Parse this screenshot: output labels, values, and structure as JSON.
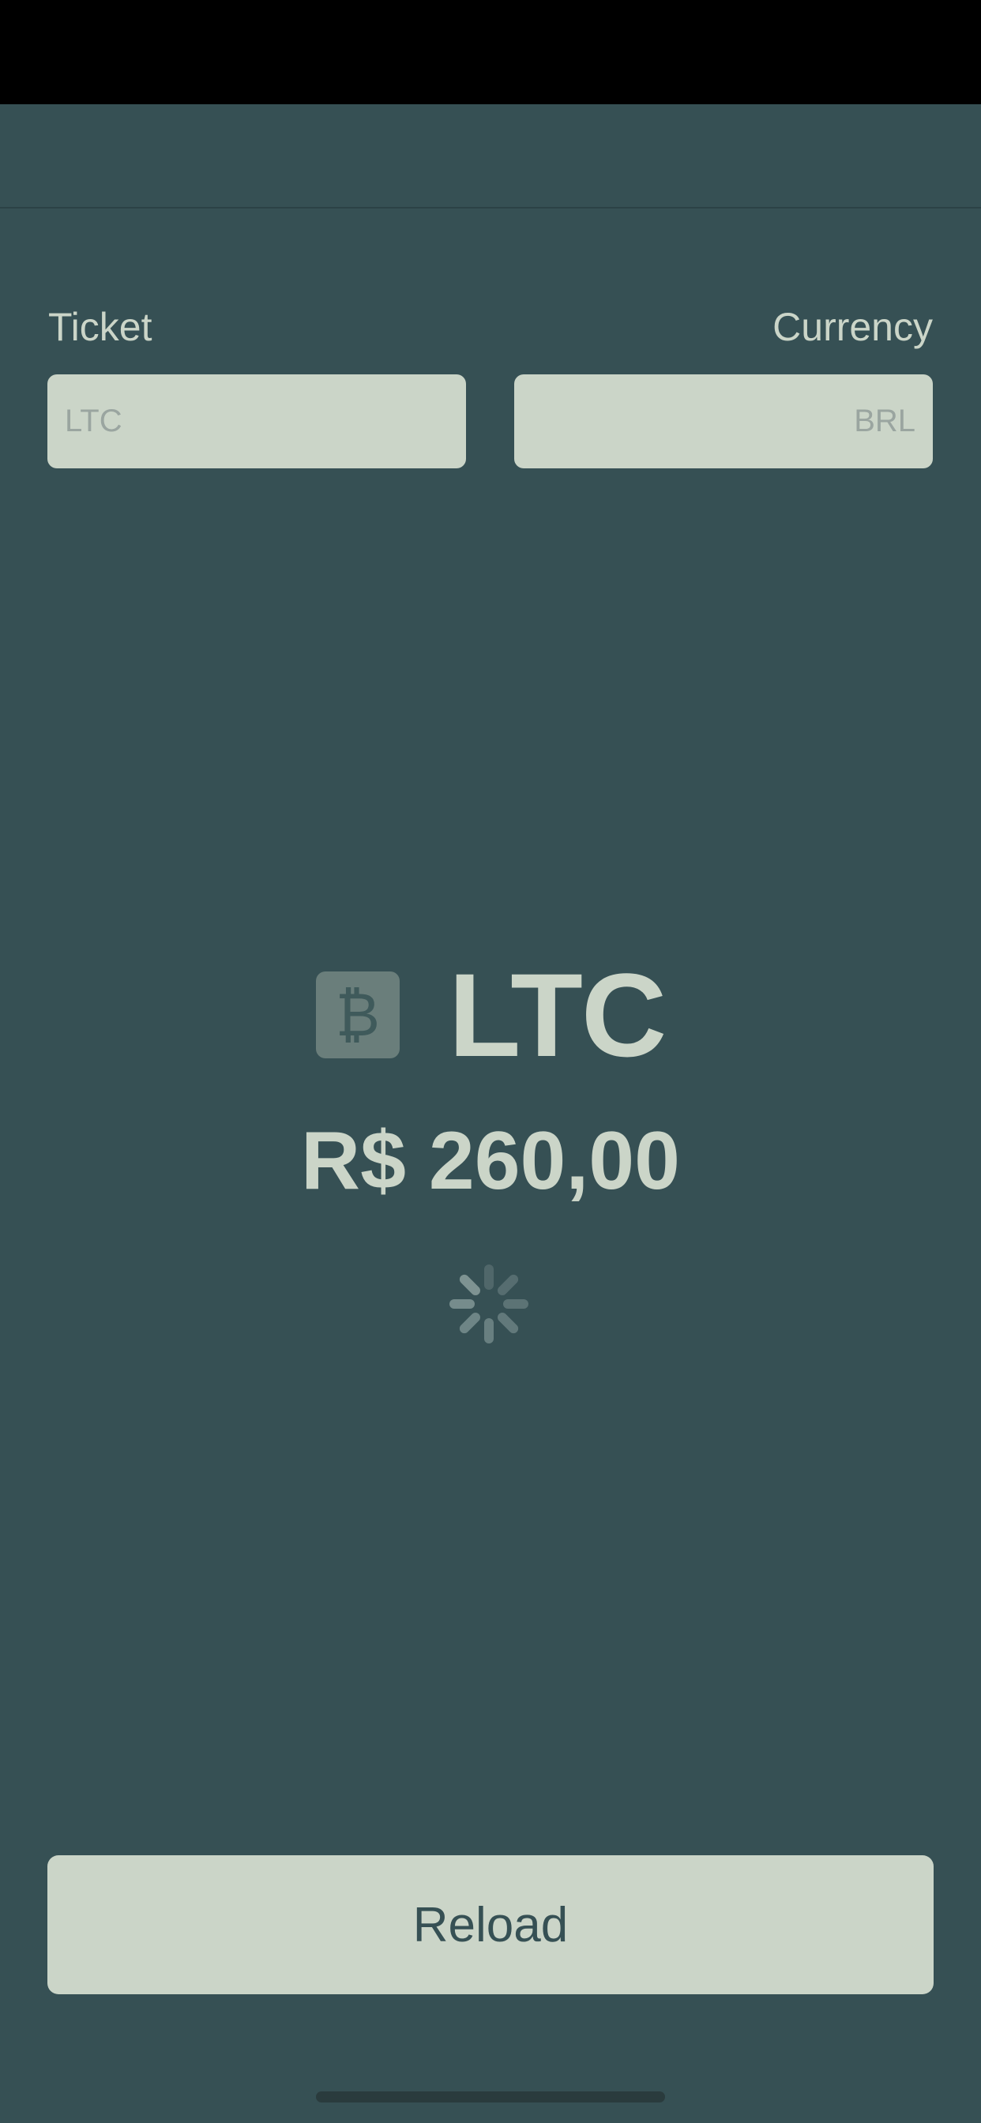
{
  "form": {
    "ticket_label": "Ticket",
    "currency_label": "Currency",
    "ticket_input": {
      "value": "",
      "placeholder": "LTC"
    },
    "currency_input": {
      "value": "",
      "placeholder": "BRL"
    }
  },
  "quote": {
    "coin_icon": "currency-icon",
    "coin_icon_glyph": "₿",
    "symbol": "LTC",
    "price": "R$ 260,00",
    "loading": true
  },
  "actions": {
    "reload_label": "Reload"
  },
  "colors": {
    "background": "#365054",
    "accent": "#cbd5c8",
    "icon_badge": "#6a7e7b"
  }
}
